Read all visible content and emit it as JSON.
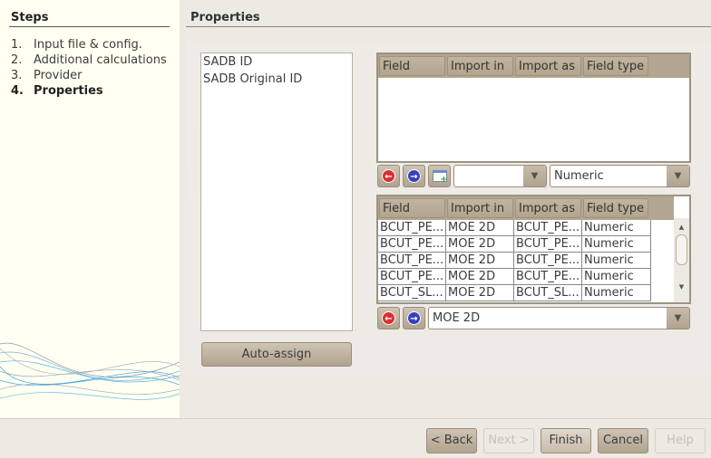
{
  "sidebar": {
    "title": "Steps",
    "steps": [
      {
        "num": "1.",
        "label": "Input file & config."
      },
      {
        "num": "2.",
        "label": "Additional calculations"
      },
      {
        "num": "3.",
        "label": "Provider"
      },
      {
        "num": "4.",
        "label": "Properties",
        "active": true
      }
    ]
  },
  "page": {
    "title": "Properties"
  },
  "field_list": [
    "SADB ID",
    "SADB Original ID"
  ],
  "auto_assign_label": "Auto-assign",
  "columns": [
    "Field",
    "Import in",
    "Import as",
    "Field type"
  ],
  "upper_table": {
    "rows": [],
    "combo1_value": "",
    "combo2_value": "Numeric"
  },
  "lower_table": {
    "rows": [
      [
        "BCUT_PE...",
        "MOE 2D",
        "BCUT_PE...",
        "Numeric"
      ],
      [
        "BCUT_PE...",
        "MOE 2D",
        "BCUT_PE...",
        "Numeric"
      ],
      [
        "BCUT_PE...",
        "MOE 2D",
        "BCUT_PE...",
        "Numeric"
      ],
      [
        "BCUT_PE...",
        "MOE 2D",
        "BCUT_PE...",
        "Numeric"
      ],
      [
        "BCUT_SL...",
        "MOE 2D",
        "BCUT_SL...",
        "Numeric"
      ]
    ],
    "combo_value": "MOE 2D"
  },
  "footer": {
    "back": "< Back",
    "next": "Next >",
    "finish": "Finish",
    "cancel": "Cancel",
    "help": "Help"
  },
  "icons": {
    "remove": "red-left-arrow-icon",
    "add": "blue-right-arrow-icon",
    "new": "new-window-plus-icon"
  }
}
